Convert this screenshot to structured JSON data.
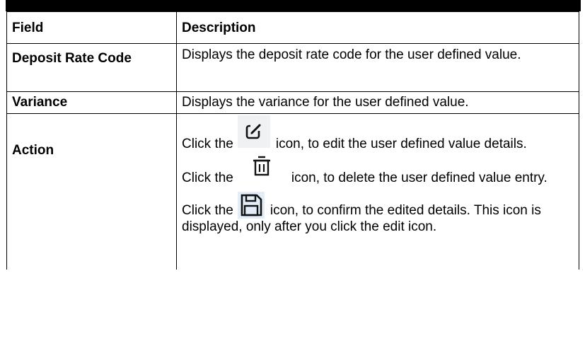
{
  "table": {
    "headers": {
      "field": "Field",
      "description": "Description"
    },
    "rows": [
      {
        "field": "Deposit Rate Code",
        "description": "Displays the deposit rate code for the user defined value."
      },
      {
        "field": "Variance",
        "description": "Displays the variance for the user defined value."
      },
      {
        "field": "Action",
        "actions": [
          {
            "prefix": "Click the",
            "icon": "edit-icon",
            "suffix": "icon, to edit the user defined value details."
          },
          {
            "prefix": "Click the",
            "icon": "trash-icon",
            "suffix": "icon, to delete the user defined value entry."
          },
          {
            "prefix": "Click the",
            "icon": "save-icon",
            "suffix": "icon, to confirm the edited details. This icon is displayed, only after you click the edit icon."
          }
        ]
      }
    ]
  }
}
